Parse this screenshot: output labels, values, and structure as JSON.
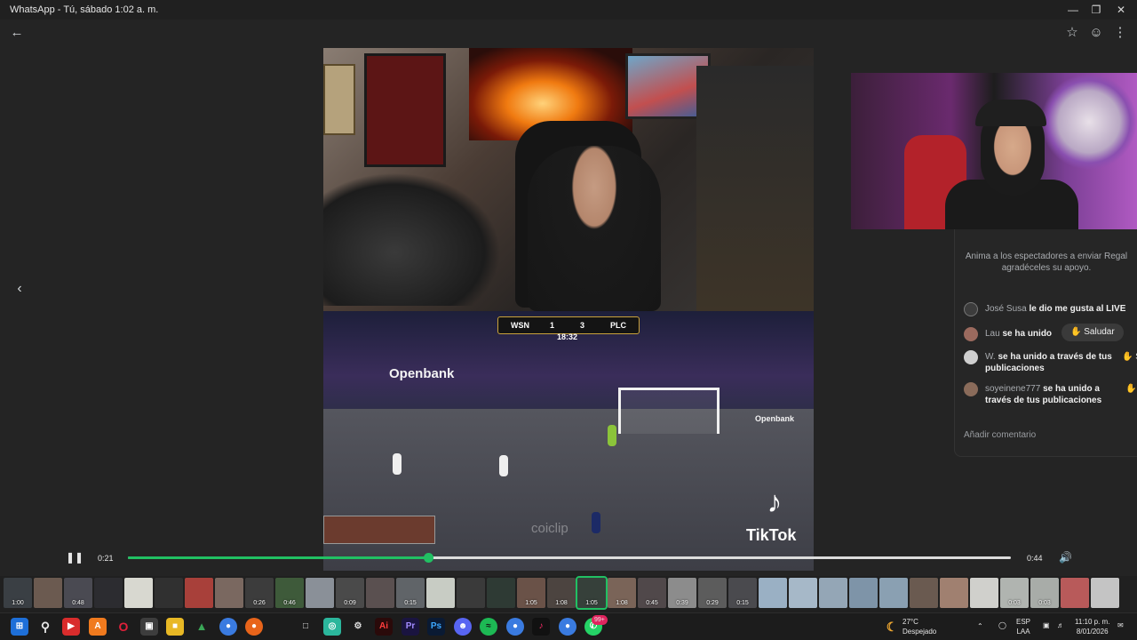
{
  "window": {
    "title": "WhatsApp - Tú, sábado 1:02 a. m.",
    "minimize_icon": "minimize-icon",
    "maximize_icon": "maximize-icon",
    "close_icon": "close-icon"
  },
  "viewer": {
    "back_icon": "back-arrow-icon",
    "star_icon": "star-icon",
    "react_icon": "smiley-icon",
    "more_icon": "more-options-icon",
    "prev_icon": "chevron-left-icon"
  },
  "video": {
    "scoreboard": {
      "home": "WSN",
      "home_score": "1",
      "away_score": "3",
      "away": "PLC",
      "time": "18:32"
    },
    "sponsor": "Openbank",
    "tiktok_text": "TikTok",
    "watermark": "coiclip"
  },
  "live": {
    "encourage_line1": "Anima a los espectadores a enviar Regal",
    "encourage_line2": "agradéceles su apoyo.",
    "comments": [
      {
        "user": "José Susa",
        "msg": "le dio me gusta al LIVE"
      },
      {
        "user": "Lau",
        "msg": "se ha unido"
      },
      {
        "user": "W.",
        "msg": "se ha unido a través de tus publicaciones"
      },
      {
        "user": "soyeinene777",
        "msg": "se ha unido a través de tus publicaciones"
      }
    ],
    "saludar": "Saludar",
    "wave_s": "S",
    "add_comment": "Añadir comentario"
  },
  "player": {
    "current": "0:21",
    "duration": "0:44",
    "progress": 0.34,
    "pause_icon": "pause-icon",
    "volume_icon": "volume-icon"
  },
  "thumbnails": [
    {
      "d": "1:00",
      "c": "#3a3f44"
    },
    {
      "d": "",
      "c": "#6b5a50"
    },
    {
      "d": "0:48",
      "c": "#4a4a52"
    },
    {
      "d": "",
      "c": "#2c2c30"
    },
    {
      "d": "",
      "c": "#d8d8d0"
    },
    {
      "d": "",
      "c": "#303030"
    },
    {
      "d": "",
      "c": "#a8403a"
    },
    {
      "d": "",
      "c": "#7a6860"
    },
    {
      "d": "0:26",
      "c": "#3c3c3c"
    },
    {
      "d": "0:46",
      "c": "#3e5a3a"
    },
    {
      "d": "",
      "c": "#8a9098"
    },
    {
      "d": "0:09",
      "c": "#4a4a4a"
    },
    {
      "d": "",
      "c": "#5a5050"
    },
    {
      "d": "0:15",
      "c": "#606468"
    },
    {
      "d": "",
      "c": "#c8ccc4"
    },
    {
      "d": "",
      "c": "#3a3a3a"
    },
    {
      "d": "",
      "c": "#2e3a34"
    },
    {
      "d": "1:05",
      "c": "#6a5248"
    },
    {
      "d": "1:08",
      "c": "#4c4440"
    },
    {
      "d": "1:05",
      "c": "#36403a"
    },
    {
      "d": "1:08",
      "c": "#7a6458"
    },
    {
      "d": "0:45",
      "c": "#50484a"
    },
    {
      "d": "0:39",
      "c": "#8c8c8c"
    },
    {
      "d": "0:29",
      "c": "#5c5c5c"
    },
    {
      "d": "0:15",
      "c": "#4a4a4e"
    },
    {
      "d": "",
      "c": "#9ab0c4"
    },
    {
      "d": "",
      "c": "#a6b8c8"
    },
    {
      "d": "",
      "c": "#94a6b6"
    },
    {
      "d": "",
      "c": "#7e94a8"
    },
    {
      "d": "",
      "c": "#8aa0b2"
    },
    {
      "d": "",
      "c": "#6a5a50"
    },
    {
      "d": "",
      "c": "#a08070"
    },
    {
      "d": "",
      "c": "#d0d0cc"
    },
    {
      "d": "0:03",
      "c": "#b0b4b0"
    },
    {
      "d": "0:03",
      "c": "#a8aca8"
    },
    {
      "d": "",
      "c": "#b85a5a"
    },
    {
      "d": "",
      "c": "#c4c4c4"
    }
  ],
  "selected_thumb": 19,
  "taskbar": {
    "weather_temp": "27°C",
    "weather_desc": "Despejado",
    "lang1": "ESP",
    "lang2": "LAA",
    "time": "11:10 p. m.",
    "date": "8/01/2026",
    "badge": "99+"
  }
}
